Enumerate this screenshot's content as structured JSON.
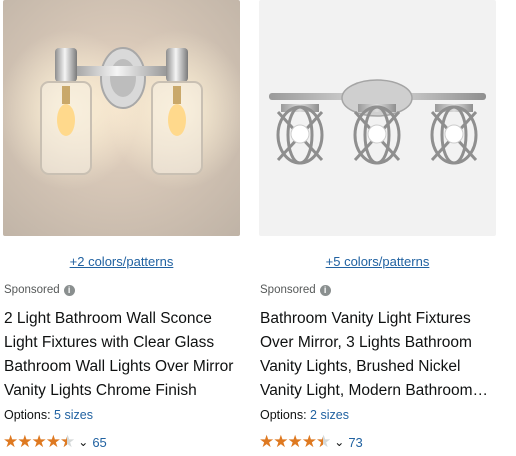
{
  "products": [
    {
      "swatch_text": "+2 colors/patterns",
      "sponsored": "Sponsored",
      "info_icon": "i",
      "title": "2 Light Bathroom Wall Sconce Light Fixtures with Clear Glass Bathroom Wall Lights Over Mirror Vanity Lights Chrome Finish",
      "options_label": "Options:",
      "options_value": "5 sizes",
      "rating_stars": 4.5,
      "review_count": "65",
      "image_icon": "two-light-sconce-image"
    },
    {
      "swatch_text": "+5 colors/patterns",
      "sponsored": "Sponsored",
      "info_icon": "i",
      "title": "Bathroom Vanity Light Fixtures Over Mirror, 3 Lights Bathroom Vanity Lights, Brushed Nickel Vanity Light, Modern Bathroom Lights",
      "options_label": "Options:",
      "options_value": "2 sizes",
      "rating_stars": 4.5,
      "review_count": "73",
      "image_icon": "three-light-vanity-image"
    }
  ],
  "colors": {
    "link": "#2162a1",
    "star": "#de7921",
    "text": "#0f1111",
    "muted": "#565959"
  }
}
